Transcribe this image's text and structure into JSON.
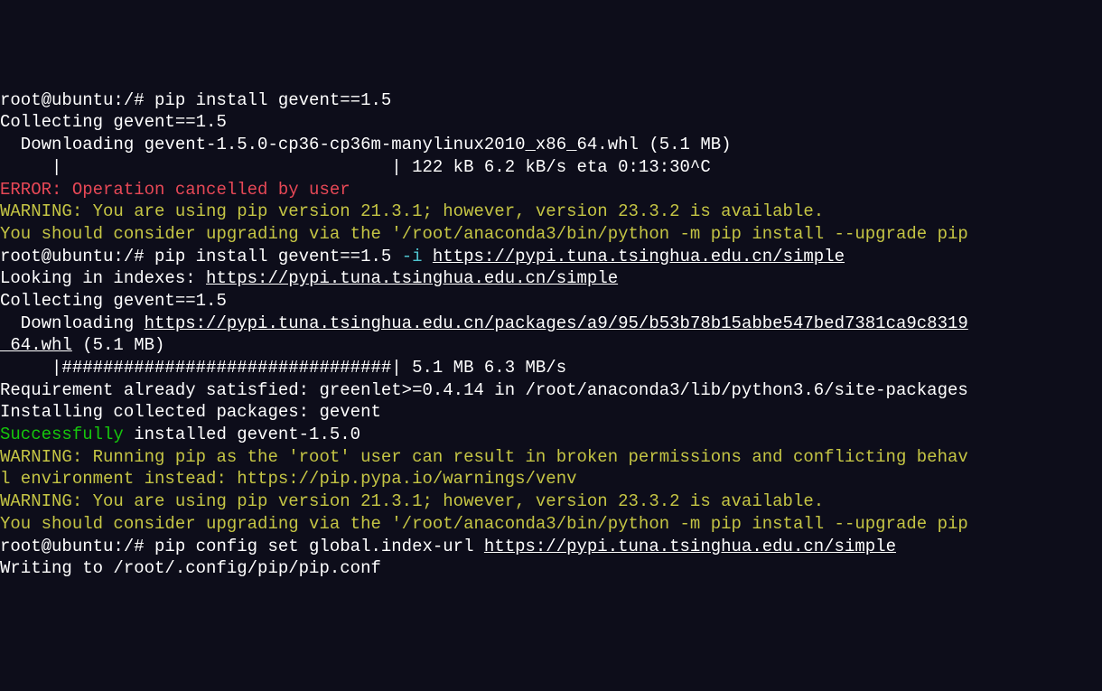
{
  "terminal": {
    "lines": [
      {
        "parts": [
          {
            "text": "root@ubuntu:/# pip install gevent==1.5",
            "class": "white"
          }
        ],
        "cutoff": true
      },
      {
        "parts": [
          {
            "text": "Collecting gevent==1.5",
            "class": "white"
          }
        ]
      },
      {
        "parts": [
          {
            "text": "  Downloading gevent-1.5.0-cp36-cp36m-manylinux2010_x86_64.whl (5.1 MB)",
            "class": "white"
          }
        ]
      },
      {
        "parts": [
          {
            "text": "     |                                | 122 kB 6.2 kB/s eta 0:13:30^C",
            "class": "white"
          }
        ]
      },
      {
        "parts": [
          {
            "text": "ERROR: Operation cancelled by user",
            "class": "red"
          }
        ]
      },
      {
        "parts": [
          {
            "text": "WARNING: You are using pip version 21.3.1; however, version 23.3.2 is available.",
            "class": "yellow"
          }
        ]
      },
      {
        "parts": [
          {
            "text": "You should consider upgrading via the '/root/anaconda3/bin/python -m pip install --upgrade pip",
            "class": "yellow"
          }
        ]
      },
      {
        "parts": [
          {
            "text": "root@ubuntu:/# pip install gevent==1.5 ",
            "class": "white"
          },
          {
            "text": "-i ",
            "class": "cyan"
          },
          {
            "text": "https://pypi.tuna.tsinghua.edu.cn/simple",
            "class": "white underline"
          }
        ]
      },
      {
        "parts": [
          {
            "text": "Looking in indexes: ",
            "class": "white"
          },
          {
            "text": "https://pypi.tuna.tsinghua.edu.cn/simple",
            "class": "white underline"
          }
        ]
      },
      {
        "parts": [
          {
            "text": "Collecting gevent==1.5",
            "class": "white"
          }
        ]
      },
      {
        "parts": [
          {
            "text": "  Downloading ",
            "class": "white"
          },
          {
            "text": "https://pypi.tuna.tsinghua.edu.cn/packages/a9/95/b53b78b15abbe547bed7381ca9c8319",
            "class": "white underline"
          }
        ]
      },
      {
        "parts": [
          {
            "text": "_64.whl",
            "class": "white underline"
          },
          {
            "text": " (5.1 MB)",
            "class": "white"
          }
        ]
      },
      {
        "parts": [
          {
            "text": "     |################################| 5.1 MB 6.3 MB/s",
            "class": "white"
          }
        ]
      },
      {
        "parts": [
          {
            "text": "Requirement already satisfied: greenlet>=0.4.14 in /root/anaconda3/lib/python3.6/site-packages",
            "class": "white"
          }
        ]
      },
      {
        "parts": [
          {
            "text": "Installing collected packages: gevent",
            "class": "white"
          }
        ]
      },
      {
        "parts": [
          {
            "text": "Successfully",
            "class": "green"
          },
          {
            "text": " installed gevent-1.5.0",
            "class": "white"
          }
        ]
      },
      {
        "parts": [
          {
            "text": "WARNING: Running pip as the 'root' user can result in broken permissions and conflicting behav",
            "class": "yellow"
          }
        ]
      },
      {
        "parts": [
          {
            "text": "l environment instead: https://pip.pypa.io/warnings/venv",
            "class": "yellow"
          }
        ]
      },
      {
        "parts": [
          {
            "text": "WARNING: You are using pip version 21.3.1; however, version 23.3.2 is available.",
            "class": "yellow"
          }
        ]
      },
      {
        "parts": [
          {
            "text": "You should consider upgrading via the '/root/anaconda3/bin/python -m pip install --upgrade pip",
            "class": "yellow"
          }
        ]
      },
      {
        "parts": [
          {
            "text": "root@ubuntu:/# pip config set global.index-url ",
            "class": "white"
          },
          {
            "text": "https://pypi.tuna.tsinghua.edu.cn/simple",
            "class": "white underline"
          }
        ]
      },
      {
        "parts": [
          {
            "text": "Writing to /root/.config/pip/pip.conf",
            "class": "white"
          }
        ]
      }
    ]
  }
}
